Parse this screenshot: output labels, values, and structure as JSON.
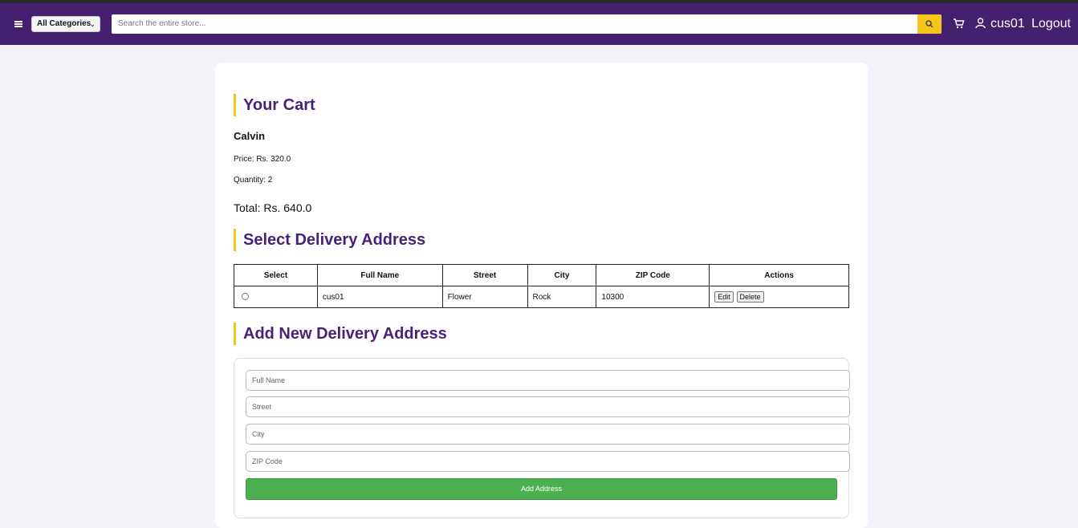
{
  "header": {
    "category_select": "All Categories",
    "search_placeholder": "Search the entire store...",
    "username": "cus01",
    "logout_label": "Logout"
  },
  "cart": {
    "title": "Your Cart",
    "product_name": "Calvin",
    "price_text": "Price: Rs. 320.0",
    "quantity_text": "Quantity: 2",
    "total_text": "Total: Rs. 640.0"
  },
  "delivery": {
    "title": "Select Delivery Address",
    "columns": [
      "Select",
      "Full Name",
      "Street",
      "City",
      "ZIP Code",
      "Actions"
    ],
    "rows": [
      {
        "full_name": "cus01",
        "street": "Flower",
        "city": "Rock",
        "zip": "10300",
        "edit_label": "Edit",
        "delete_label": "Delete"
      }
    ]
  },
  "new_address": {
    "title": "Add New Delivery Address",
    "full_name_placeholder": "Full Name",
    "street_placeholder": "Street",
    "city_placeholder": "City",
    "zip_placeholder": "ZIP Code",
    "submit_label": "Add Address"
  },
  "colors": {
    "navbar": "#44206f",
    "accent": "#f5c518",
    "heading": "#4a1f7a",
    "submit": "#4caf50"
  },
  "icons": [
    "menu-icon",
    "chevron-down-icon",
    "search-icon",
    "cart-icon",
    "user-icon"
  ]
}
